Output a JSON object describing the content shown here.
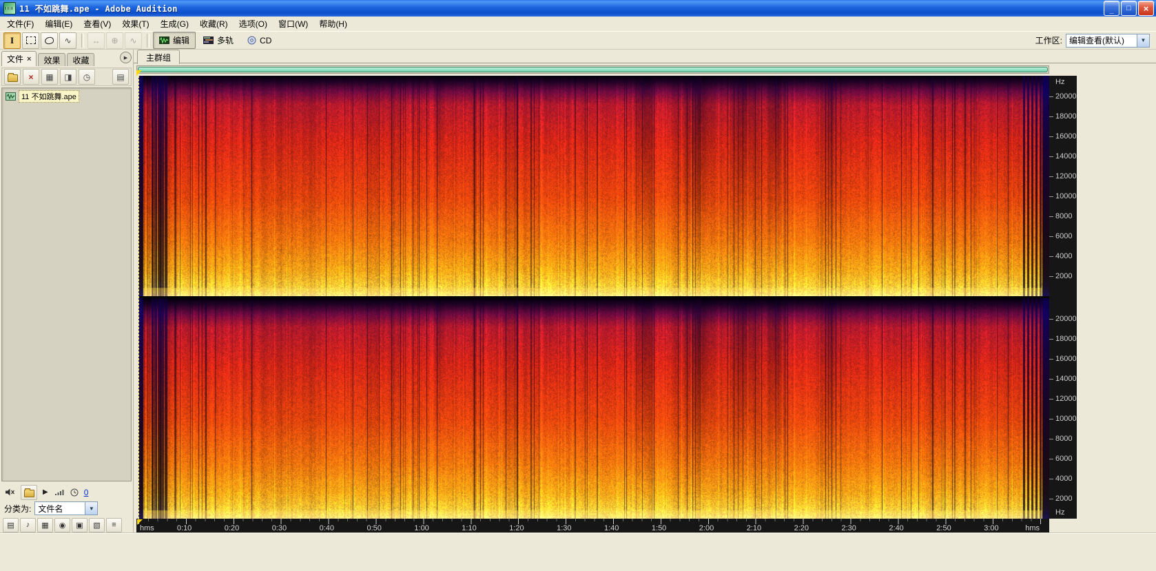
{
  "window": {
    "title": "11 不如跳舞.ape - Adobe Audition",
    "controls": {
      "minimize": "_",
      "maximize": "□",
      "close": "×"
    }
  },
  "menu": {
    "items": [
      "文件(F)",
      "编辑(E)",
      "查看(V)",
      "效果(T)",
      "生成(G)",
      "收藏(R)",
      "选项(O)",
      "窗口(W)",
      "帮助(H)"
    ]
  },
  "toolbar": {
    "views": [
      {
        "label": "编辑"
      },
      {
        "label": "多轨"
      },
      {
        "label": "CD"
      }
    ],
    "workspace_label": "工作区:",
    "workspace_value": "编辑查看(默认)"
  },
  "left_panel": {
    "tabs": [
      {
        "label": "文件"
      },
      {
        "label": "效果"
      },
      {
        "label": "收藏"
      }
    ],
    "files": [
      {
        "name": "11 不如跳舞.ape"
      }
    ],
    "sort_label": "分类为:",
    "sort_value": "文件名",
    "autoplay_time": "0"
  },
  "main": {
    "group_tab": "主群组",
    "freq_unit": "Hz",
    "freq_ticks": [
      "20000",
      "18000",
      "16000",
      "14000",
      "12000",
      "10000",
      "8000",
      "6000",
      "4000",
      "2000"
    ],
    "time_unit_left": "hms",
    "time_unit_right": "hms",
    "time_ticks": [
      "0:10",
      "0:20",
      "0:30",
      "0:40",
      "0:50",
      "1:00",
      "1:10",
      "1:20",
      "1:30",
      "1:40",
      "1:50",
      "2:00",
      "2:10",
      "2:20",
      "2:30",
      "2:40",
      "2:50",
      "3:00"
    ]
  },
  "icons": {
    "play": "▶",
    "dropdown_arrow": "▼",
    "panel_menu_arrow": "▶",
    "tab_close": "×",
    "time_selection_tool": "I",
    "move_tool": "↔",
    "hybrid_tool": "⊕",
    "scrub_tool": "∿",
    "close_file": "×",
    "insert_multitrack": "▦",
    "insert_cd": "◨",
    "autoplay_clock": "◷",
    "advanced_options": "▤",
    "filter_icons": [
      "▤",
      "♪",
      "▦",
      "◉",
      "▣",
      "▧",
      "≡"
    ]
  },
  "colors": {
    "titlebar_blue": "#1c64dd",
    "panel_tan": "#ece9d8",
    "range_bar_green": "#8fdfc0",
    "marker_yellow": "#ffd800",
    "spectro_low_energy": "#1a0028",
    "spectro_mid_energy": "#dd2200",
    "spectro_high_energy": "#ffdd55"
  }
}
